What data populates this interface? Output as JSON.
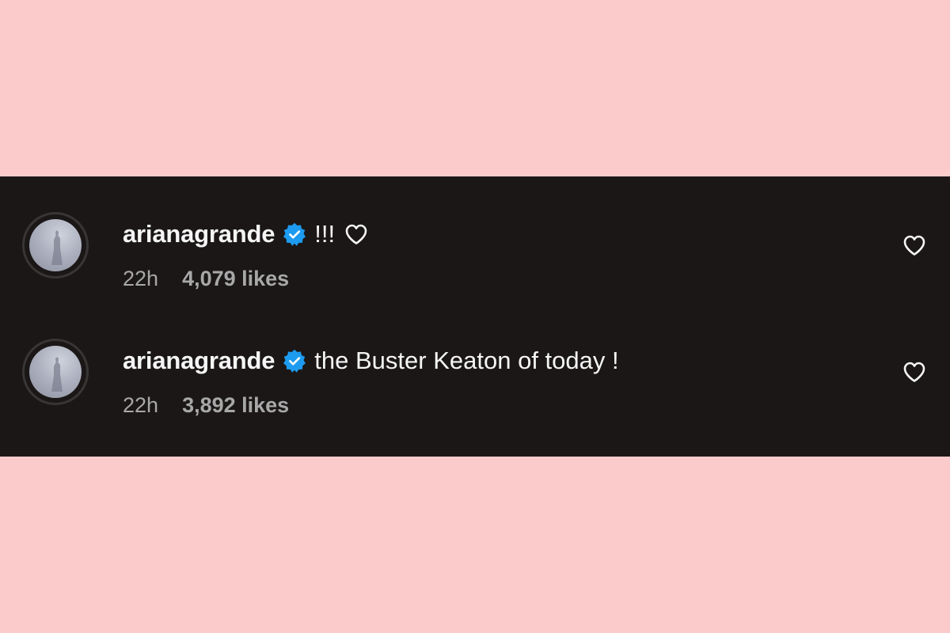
{
  "colors": {
    "page_background": "#fbcbcc",
    "panel_background": "#1b1717",
    "username_text": "#f5f5f5",
    "meta_text": "#a8a8a8",
    "verified_badge": "#1d9bf0"
  },
  "comments": [
    {
      "username": "arianagrande",
      "verified": true,
      "text": "!!!",
      "inline_icon": "heart-outline-icon",
      "time": "22h",
      "likes": "4,079 likes",
      "like_icon": "heart-outline-icon"
    },
    {
      "username": "arianagrande",
      "verified": true,
      "text": "the Buster Keaton of today !",
      "time": "22h",
      "likes": "3,892 likes",
      "like_icon": "heart-outline-icon"
    }
  ]
}
